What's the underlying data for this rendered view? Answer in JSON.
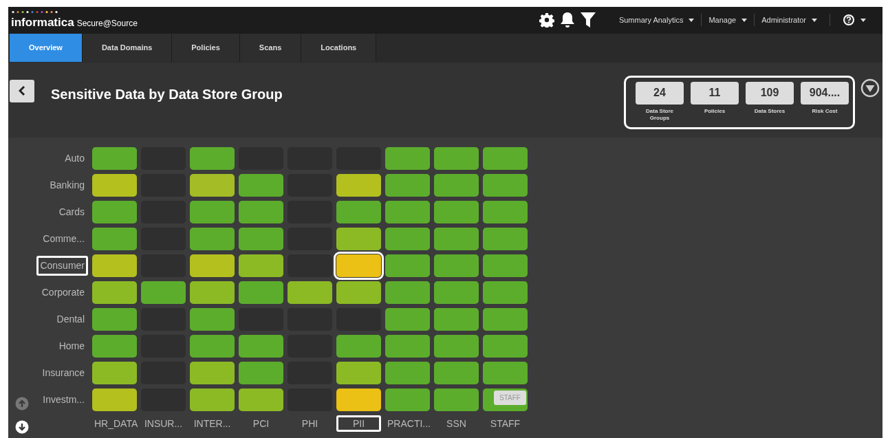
{
  "header": {
    "brand": "informatica",
    "product": "Secure@Source",
    "menus": [
      {
        "label": "Summary Analytics"
      },
      {
        "label": "Manage"
      },
      {
        "label": "Administrator"
      }
    ]
  },
  "tabs": [
    {
      "label": "Overview",
      "selected": true
    },
    {
      "label": "Data Domains",
      "selected": false
    },
    {
      "label": "Policies",
      "selected": false
    },
    {
      "label": "Scans",
      "selected": false
    },
    {
      "label": "Locations",
      "selected": false
    }
  ],
  "page_title": "Sensitive Data by Data Store Group",
  "stats": [
    {
      "value": "24",
      "label": "Data Store Groups"
    },
    {
      "value": "11",
      "label": "Policies"
    },
    {
      "value": "109",
      "label": "Data Stores"
    },
    {
      "value": "904....",
      "label": "Risk Cost"
    }
  ],
  "heatmap": {
    "columns": [
      {
        "label": "HR_DATA",
        "selected": false
      },
      {
        "label": "INSUR...",
        "selected": false
      },
      {
        "label": "INTER...",
        "selected": false
      },
      {
        "label": "PCI",
        "selected": false
      },
      {
        "label": "PHI",
        "selected": false
      },
      {
        "label": "PII",
        "selected": true
      },
      {
        "label": "PRACTI...",
        "selected": false
      },
      {
        "label": "SSN",
        "selected": false
      },
      {
        "label": "STAFF",
        "selected": false
      }
    ],
    "rows": [
      {
        "label": "Auto",
        "selected": false,
        "cells": [
          {
            "color": "#5cad2c"
          },
          {
            "color": "#2f2f2f"
          },
          {
            "color": "#5cad2c"
          },
          {
            "color": "#2f2f2f"
          },
          {
            "color": "#2f2f2f"
          },
          {
            "color": "#2f2f2f"
          },
          {
            "color": "#5cad2c"
          },
          {
            "color": "#5cad2c"
          },
          {
            "color": "#5cad2c"
          }
        ]
      },
      {
        "label": "Banking",
        "selected": false,
        "cells": [
          {
            "color": "#b3c01e"
          },
          {
            "color": "#2f2f2f"
          },
          {
            "color": "#a4bc26"
          },
          {
            "color": "#5cad2c"
          },
          {
            "color": "#2f2f2f"
          },
          {
            "color": "#b3c01e"
          },
          {
            "color": "#5cad2c"
          },
          {
            "color": "#5cad2c"
          },
          {
            "color": "#5cad2c"
          }
        ]
      },
      {
        "label": "Cards",
        "selected": false,
        "cells": [
          {
            "color": "#5cad2c"
          },
          {
            "color": "#2f2f2f"
          },
          {
            "color": "#5cad2c"
          },
          {
            "color": "#5cad2c"
          },
          {
            "color": "#2f2f2f"
          },
          {
            "color": "#5cad2c"
          },
          {
            "color": "#5cad2c"
          },
          {
            "color": "#5cad2c"
          },
          {
            "color": "#5cad2c"
          }
        ]
      },
      {
        "label": "Comme...",
        "selected": false,
        "cells": [
          {
            "color": "#5cad2c"
          },
          {
            "color": "#2f2f2f"
          },
          {
            "color": "#5cad2c"
          },
          {
            "color": "#5cad2c"
          },
          {
            "color": "#2f2f2f"
          },
          {
            "color": "#8cba24"
          },
          {
            "color": "#5cad2c"
          },
          {
            "color": "#5cad2c"
          },
          {
            "color": "#5cad2c"
          }
        ]
      },
      {
        "label": "Consumer",
        "selected": true,
        "cells": [
          {
            "color": "#b3c01e"
          },
          {
            "color": "#2f2f2f"
          },
          {
            "color": "#b3c01e"
          },
          {
            "color": "#8cba24"
          },
          {
            "color": "#2f2f2f"
          },
          {
            "color": "#eac114"
          },
          {
            "color": "#5cad2c"
          },
          {
            "color": "#5cad2c"
          },
          {
            "color": "#5cad2c"
          }
        ]
      },
      {
        "label": "Corporate",
        "selected": false,
        "cells": [
          {
            "color": "#8cba24"
          },
          {
            "color": "#5cad2c"
          },
          {
            "color": "#8cba24"
          },
          {
            "color": "#5cad2c"
          },
          {
            "color": "#8cba24"
          },
          {
            "color": "#8cba24"
          },
          {
            "color": "#5cad2c"
          },
          {
            "color": "#5cad2c"
          },
          {
            "color": "#5cad2c"
          }
        ]
      },
      {
        "label": "Dental",
        "selected": false,
        "cells": [
          {
            "color": "#5cad2c"
          },
          {
            "color": "#2f2f2f"
          },
          {
            "color": "#5cad2c"
          },
          {
            "color": "#2f2f2f"
          },
          {
            "color": "#2f2f2f"
          },
          {
            "color": "#2f2f2f"
          },
          {
            "color": "#5cad2c"
          },
          {
            "color": "#5cad2c"
          },
          {
            "color": "#5cad2c"
          }
        ]
      },
      {
        "label": "Home",
        "selected": false,
        "cells": [
          {
            "color": "#5cad2c"
          },
          {
            "color": "#2f2f2f"
          },
          {
            "color": "#5cad2c"
          },
          {
            "color": "#5cad2c"
          },
          {
            "color": "#2f2f2f"
          },
          {
            "color": "#5cad2c"
          },
          {
            "color": "#5cad2c"
          },
          {
            "color": "#5cad2c"
          },
          {
            "color": "#5cad2c"
          }
        ]
      },
      {
        "label": "Insurance",
        "selected": false,
        "cells": [
          {
            "color": "#8cba24"
          },
          {
            "color": "#2f2f2f"
          },
          {
            "color": "#8cba24"
          },
          {
            "color": "#5cad2c"
          },
          {
            "color": "#2f2f2f"
          },
          {
            "color": "#8cba24"
          },
          {
            "color": "#5cad2c"
          },
          {
            "color": "#5cad2c"
          },
          {
            "color": "#5cad2c"
          }
        ]
      },
      {
        "label": "Investm...",
        "selected": false,
        "cells": [
          {
            "color": "#b3c01e"
          },
          {
            "color": "#2f2f2f"
          },
          {
            "color": "#8cba24"
          },
          {
            "color": "#8cba24"
          },
          {
            "color": "#2f2f2f"
          },
          {
            "color": "#eac114"
          },
          {
            "color": "#5cad2c"
          },
          {
            "color": "#5cad2c"
          },
          {
            "color": "#5cad2c"
          }
        ]
      }
    ],
    "tooltip": {
      "text": "STAFF"
    }
  },
  "scroll_buttons": [
    {
      "kind": "up",
      "disabled": true
    },
    {
      "kind": "down",
      "disabled": false
    }
  ]
}
